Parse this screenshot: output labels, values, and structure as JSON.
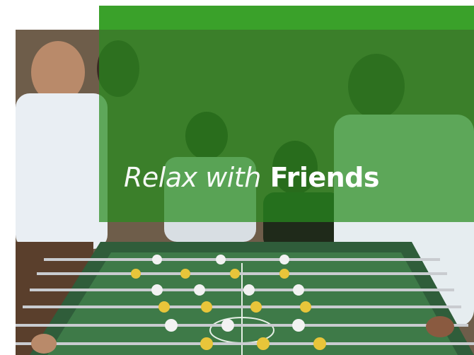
{
  "headline": {
    "light": "Relax with",
    "bold": "Friends"
  },
  "colors": {
    "accent_green": "#3aa12a",
    "overlay_green": "#288c1e",
    "text": "#ffffff"
  },
  "image": {
    "subject": "friends-playing-foosball-photo"
  }
}
